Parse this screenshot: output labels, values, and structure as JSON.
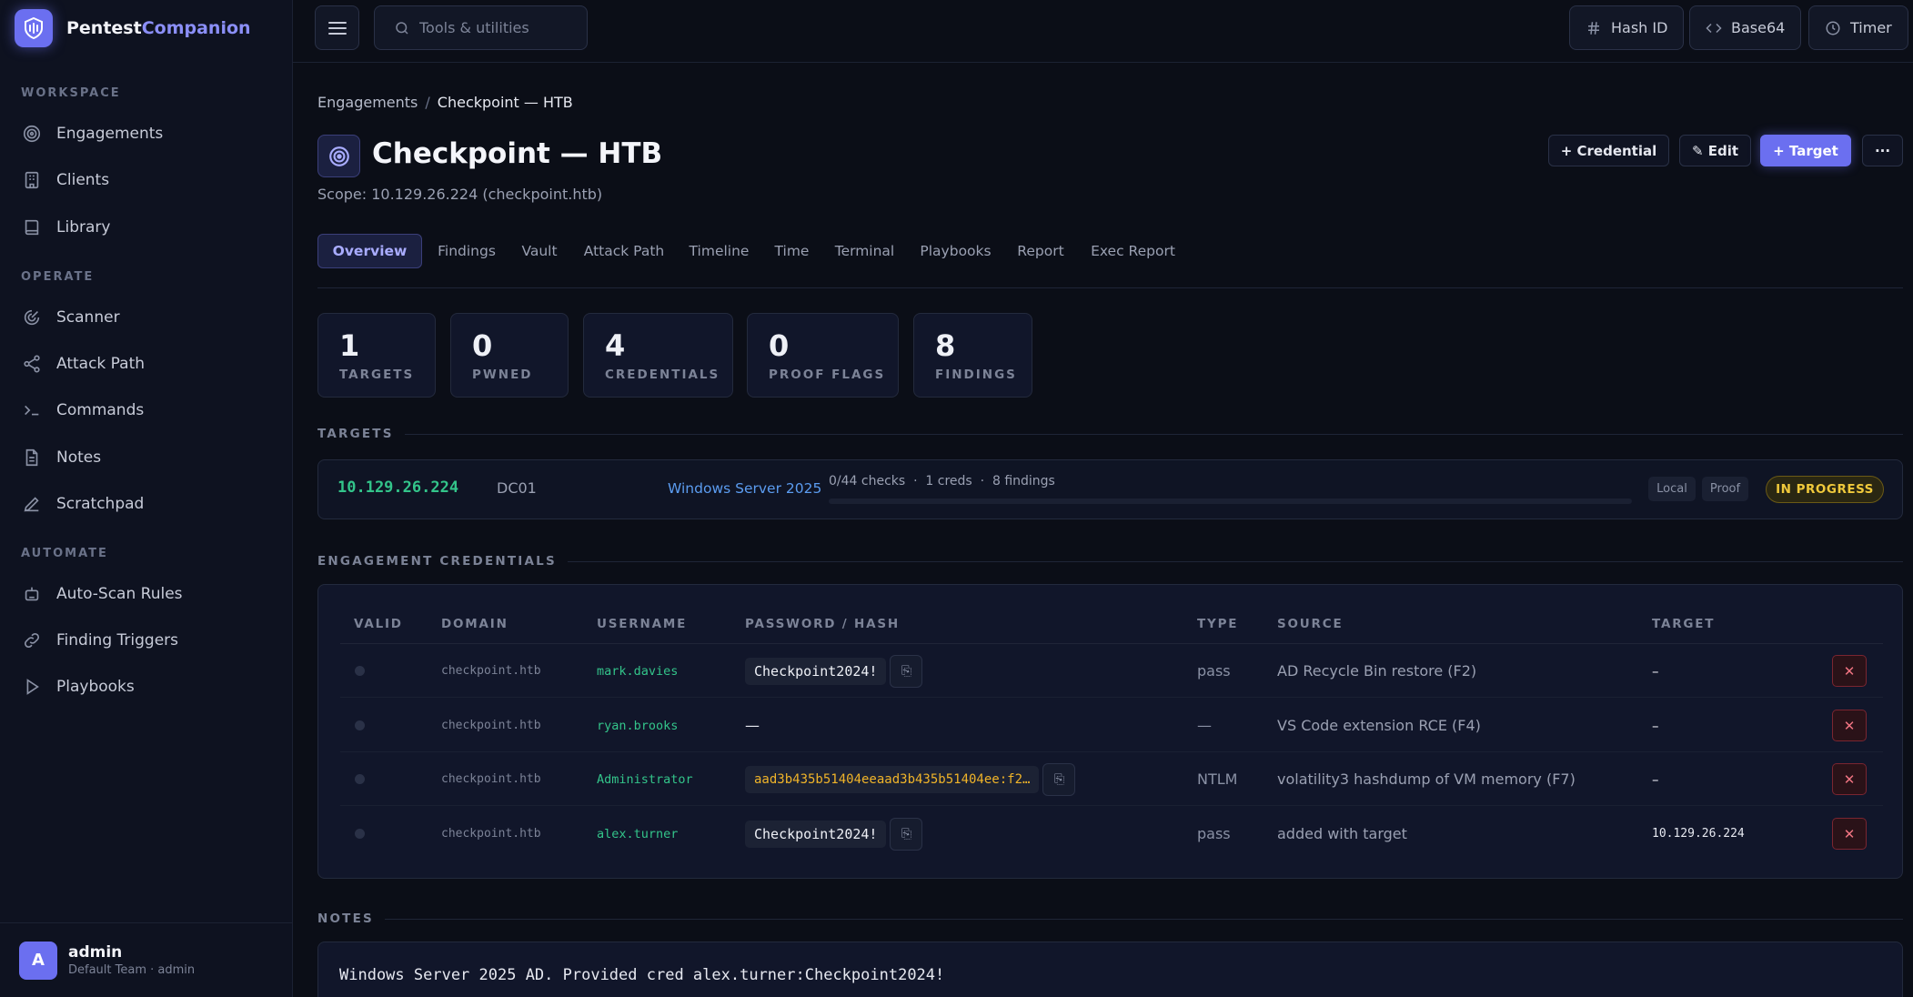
{
  "brand": {
    "name_part1": "Pentest",
    "name_part2": "Companion"
  },
  "sidebar": {
    "sections": [
      {
        "title": "WORKSPACE",
        "items": [
          {
            "label": "Engagements",
            "icon": "target-icon"
          },
          {
            "label": "Clients",
            "icon": "building-icon"
          },
          {
            "label": "Library",
            "icon": "book-icon"
          }
        ]
      },
      {
        "title": "OPERATE",
        "items": [
          {
            "label": "Scanner",
            "icon": "radar-icon"
          },
          {
            "label": "Attack Path",
            "icon": "share-icon"
          },
          {
            "label": "Commands",
            "icon": "terminal-icon"
          },
          {
            "label": "Notes",
            "icon": "file-icon"
          },
          {
            "label": "Scratchpad",
            "icon": "pencil-icon"
          }
        ]
      },
      {
        "title": "AUTOMATE",
        "items": [
          {
            "label": "Auto-Scan Rules",
            "icon": "robot-icon"
          },
          {
            "label": "Finding Triggers",
            "icon": "link-icon"
          },
          {
            "label": "Playbooks",
            "icon": "play-icon"
          }
        ]
      }
    ],
    "user": {
      "initial": "A",
      "name": "admin",
      "sub": "Default Team · admin"
    }
  },
  "topbar": {
    "search_placeholder": "Tools & utilities",
    "tools": [
      {
        "label": "Hash ID",
        "icon": "hash-icon"
      },
      {
        "label": "Base64",
        "icon": "code-icon"
      },
      {
        "label": "Timer",
        "icon": "clock-icon"
      }
    ]
  },
  "breadcrumb": {
    "parent": "Engagements",
    "sep": "/",
    "current": "Checkpoint — HTB"
  },
  "page": {
    "title": "Checkpoint — HTB",
    "scope": "Scope: 10.129.26.224 (checkpoint.htb)",
    "actions": {
      "credential": "+ Credential",
      "edit": "✎ Edit",
      "target": "+ Target",
      "more": "···"
    }
  },
  "tabs": [
    "Overview",
    "Findings",
    "Vault",
    "Attack Path",
    "Timeline",
    "Time",
    "Terminal",
    "Playbooks",
    "Report",
    "Exec Report"
  ],
  "active_tab": "Overview",
  "stats": [
    {
      "value": "1",
      "label": "TARGETS"
    },
    {
      "value": "0",
      "label": "PWNED"
    },
    {
      "value": "4",
      "label": "CREDENTIALS"
    },
    {
      "value": "0",
      "label": "PROOF FLAGS"
    },
    {
      "value": "8",
      "label": "FINDINGS"
    }
  ],
  "targets_heading": "TARGETS",
  "target": {
    "ip": "10.129.26.224",
    "hostname": "DC01",
    "os": "Windows Server 2025",
    "meta": "0/44 checks  ·  1 creds  ·  8 findings",
    "progress": 0,
    "tags": [
      "Local",
      "Proof"
    ],
    "status": "IN PROGRESS"
  },
  "credentials_heading": "ENGAGEMENT CREDENTIALS",
  "cred_columns": [
    "VALID",
    "DOMAIN",
    "USERNAME",
    "PASSWORD / HASH",
    "TYPE",
    "SOURCE",
    "TARGET"
  ],
  "credentials": [
    {
      "domain": "checkpoint.htb",
      "username": "mark.davies",
      "secret": "Checkpoint2024!",
      "secret_kind": "pass",
      "type": "pass",
      "source": "AD Recycle Bin restore (F2)",
      "target": "–"
    },
    {
      "domain": "checkpoint.htb",
      "username": "ryan.brooks",
      "secret": "—",
      "secret_kind": "none",
      "type": "—",
      "source": "VS Code extension RCE (F4)",
      "target": "–"
    },
    {
      "domain": "checkpoint.htb",
      "username": "Administrator",
      "secret": "aad3b435b51404eeaad3b435b51404ee:f2…",
      "secret_kind": "hash",
      "type": "NTLM",
      "source": "volatility3 hashdump of VM memory (F7)",
      "target": "–"
    },
    {
      "domain": "checkpoint.htb",
      "username": "alex.turner",
      "secret": "Checkpoint2024!",
      "secret_kind": "pass",
      "type": "pass",
      "source": "added with target",
      "target": "10.129.26.224"
    }
  ],
  "copy_glyph": "⎘",
  "delete_glyph": "✕",
  "notes_heading": "NOTES",
  "notes_text": "Windows Server 2025 AD. Provided cred alex.turner:Checkpoint2024!",
  "colors": {
    "accent": "#6b6ff0",
    "ip_green": "#33c48a",
    "status_yellow": "#f0c93b",
    "hash_amber": "#f0b429",
    "danger": "#f07482"
  }
}
